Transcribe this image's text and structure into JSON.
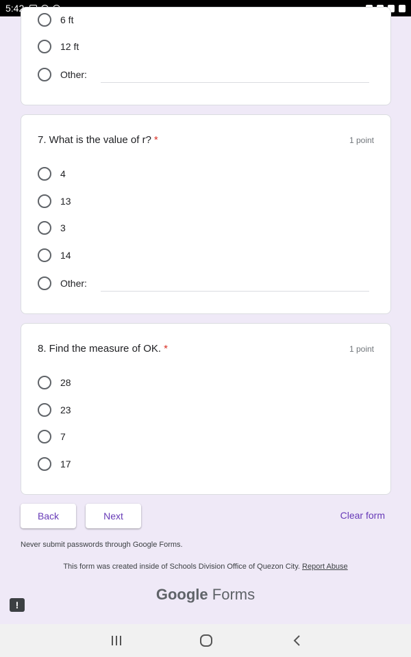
{
  "status_bar": {
    "time": "5:42"
  },
  "question6_partial": {
    "options": [
      "6 ft",
      "12 ft"
    ],
    "other_label": "Other:"
  },
  "question7": {
    "title": "7. What is the value of r?",
    "required_mark": "*",
    "points": "1 point",
    "options": [
      "4",
      "13",
      "3",
      "14"
    ],
    "other_label": "Other:"
  },
  "question8": {
    "title": "8. Find the measure of OK.",
    "required_mark": "*",
    "points": "1 point",
    "options": [
      "28",
      "23",
      "7",
      "17"
    ]
  },
  "nav": {
    "back_label": "Back",
    "next_label": "Next",
    "clear_label": "Clear form"
  },
  "footer": {
    "note": "Never submit passwords through Google Forms.",
    "created_text": "This form was created inside of Schools Division Office of Quezon City.",
    "report_label": "Report Abuse",
    "brand_google": "Google",
    "brand_forms": "Forms"
  },
  "colors": {
    "background": "#efe9f7",
    "accent": "#673ab7",
    "required": "#d93025"
  },
  "icons": {
    "feedback": "exclamation-icon",
    "nav_recent": "recent-apps-icon",
    "nav_home": "home-icon",
    "nav_back": "back-icon"
  }
}
